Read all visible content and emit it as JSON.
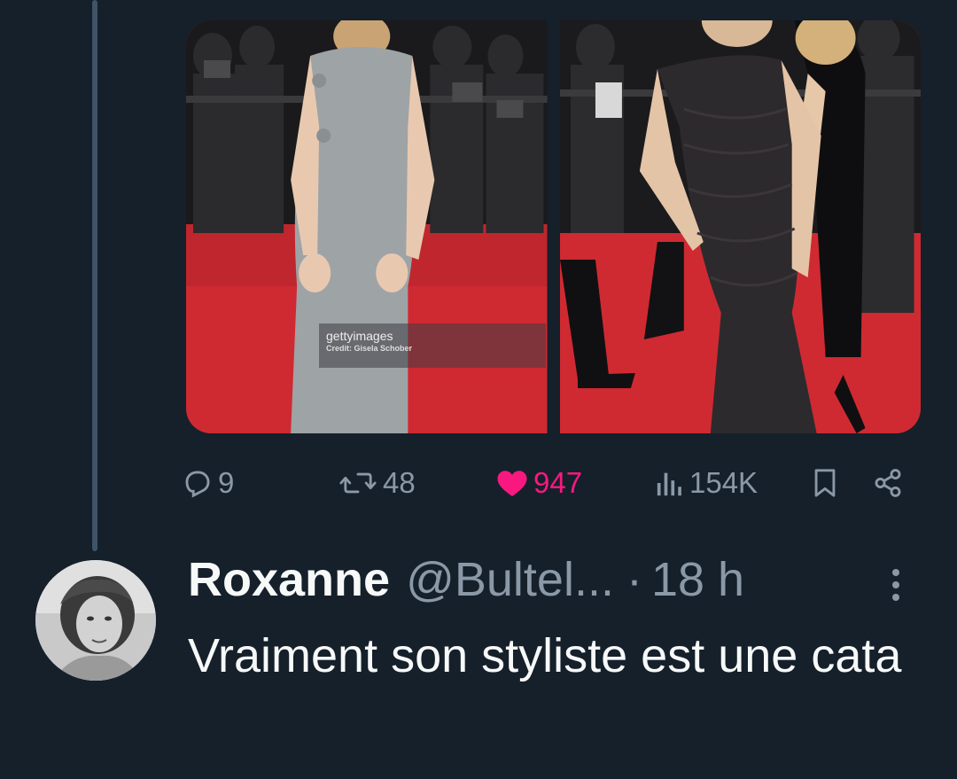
{
  "media": {
    "left_photo": {
      "description_icon": "photo-gray-dress"
    },
    "right_photo": {
      "description_icon": "photo-black-dress"
    },
    "watermark": {
      "brand": "gettyimages",
      "credit": "Credit: Gisela Schober"
    }
  },
  "actions": {
    "replies": "9",
    "reposts": "48",
    "likes": "947",
    "views": "154K"
  },
  "reply": {
    "display_name": "Roxanne",
    "handle": "@Bultel...",
    "separator": "·",
    "time": "18 h",
    "text": "Vraiment son styliste est une cata"
  },
  "colors": {
    "background": "#15202b",
    "thread_line": "#3e5468",
    "secondary_text": "#8b98a5",
    "like_pink": "#f91880",
    "primary_text": "#f7f9f9"
  }
}
